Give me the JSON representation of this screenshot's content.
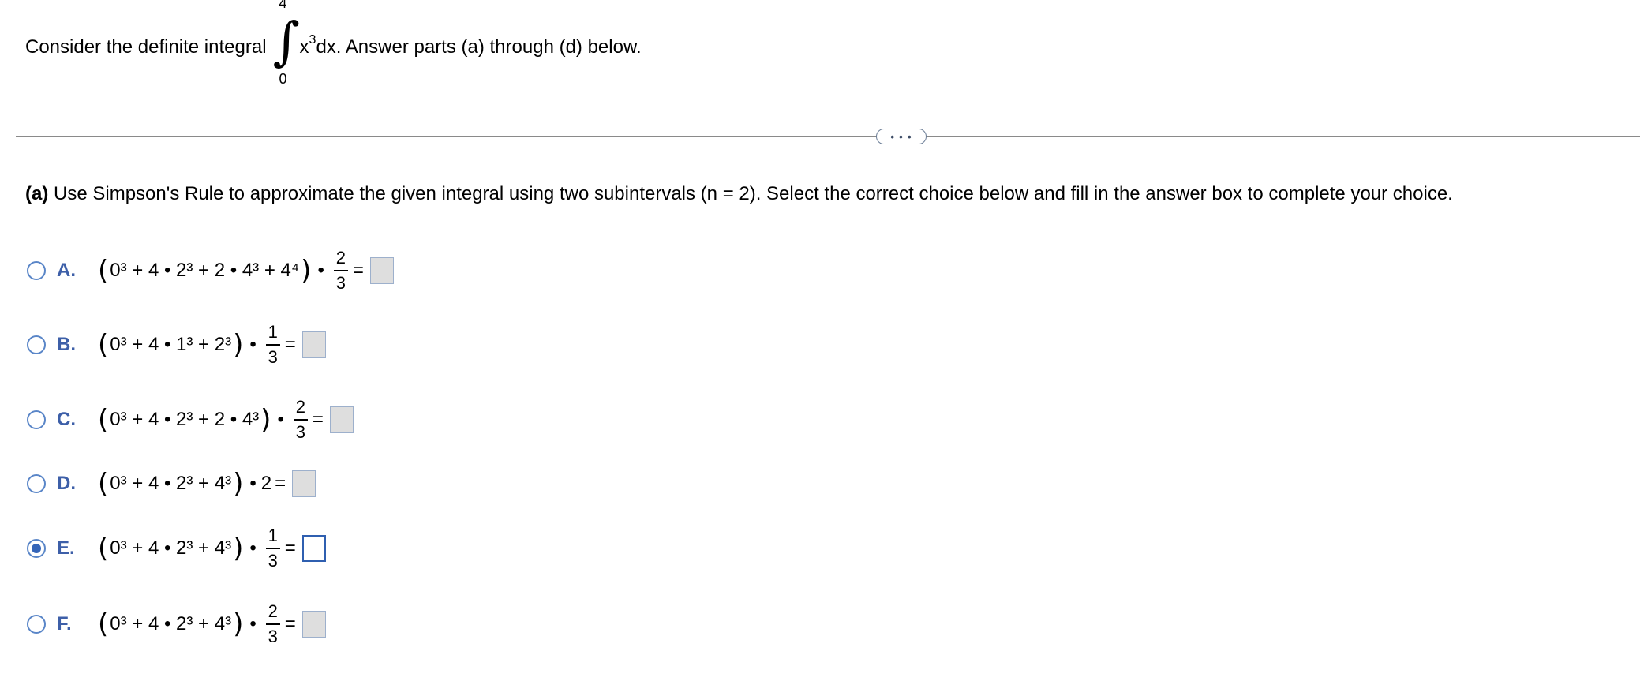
{
  "question": {
    "prefix": "Consider the definite integral",
    "upper": "4",
    "lower": "0",
    "integrand_base": "x",
    "integrand_exp": "3",
    "suffix": "dx. Answer parts (a) through (d) below."
  },
  "more_button": "• • •",
  "part_a": {
    "label": "(a)",
    "text": "Use Simpson's Rule to approximate the given integral using two subintervals (n = 2). Select the correct choice below and fill in the answer box to complete your choice."
  },
  "choices": [
    {
      "letter": "A.",
      "body": "0³ + 4 • 2³ + 2 • 4³ + 4⁴",
      "frac_num": "2",
      "frac_den": "3",
      "selected": false
    },
    {
      "letter": "B.",
      "body": "0³ + 4 • 1³ + 2³",
      "frac_num": "1",
      "frac_den": "3",
      "selected": false
    },
    {
      "letter": "C.",
      "body": "0³ + 4 • 2³ + 2 • 4³",
      "frac_num": "2",
      "frac_den": "3",
      "selected": false
    },
    {
      "letter": "D.",
      "body": "0³ + 4 • 2³ + 4³",
      "multiplier": "2",
      "selected": false
    },
    {
      "letter": "E.",
      "body": "0³ + 4 • 2³ + 4³",
      "frac_num": "1",
      "frac_den": "3",
      "selected": true
    },
    {
      "letter": "F.",
      "body": "0³ + 4 • 2³ + 4³",
      "frac_num": "2",
      "frac_den": "3",
      "selected": false
    }
  ],
  "colors": {
    "accent": "#3d5fa8",
    "radio": "#5a86c8",
    "box_inactive": "#dedede"
  }
}
